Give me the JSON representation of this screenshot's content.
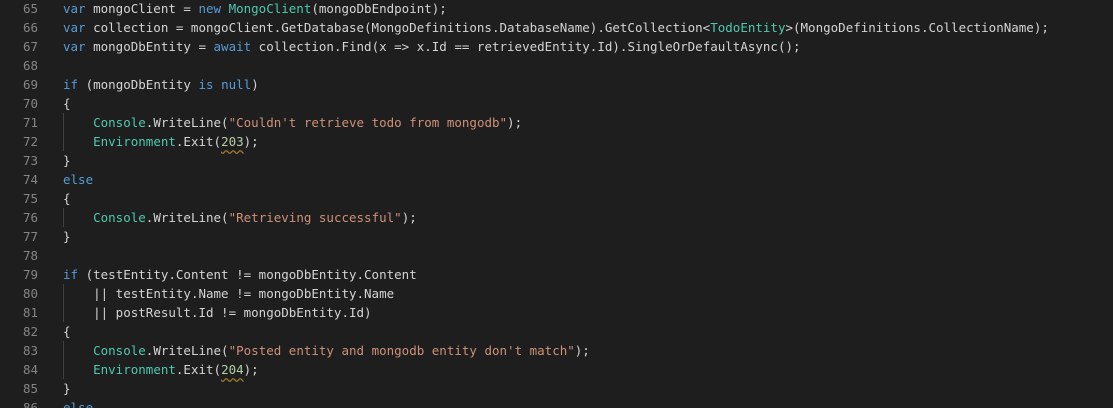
{
  "editor": {
    "colors": {
      "background": "#1e1e1e",
      "keyword": "#569cd6",
      "type": "#4ec9b0",
      "string": "#ce9178",
      "number": "#b5cea8",
      "text": "#d4d4d4",
      "line_number": "#858585"
    },
    "lines": [
      {
        "number": "65",
        "indent": 0,
        "tokens": [
          {
            "t": "var",
            "c": "kw"
          },
          {
            "t": " mongoClient = ",
            "c": "pl"
          },
          {
            "t": "new",
            "c": "kw"
          },
          {
            "t": " ",
            "c": "pl"
          },
          {
            "t": "MongoClient",
            "c": "ty"
          },
          {
            "t": "(mongoDbEndpoint);",
            "c": "pl"
          }
        ]
      },
      {
        "number": "66",
        "indent": 0,
        "tokens": [
          {
            "t": "var",
            "c": "kw"
          },
          {
            "t": " collection = mongoClient.GetDatabase(MongoDefinitions.DatabaseName).GetCollection<",
            "c": "pl"
          },
          {
            "t": "TodoEntity",
            "c": "ty"
          },
          {
            "t": ">(MongoDefinitions.CollectionName);",
            "c": "pl"
          }
        ]
      },
      {
        "number": "67",
        "indent": 0,
        "tokens": [
          {
            "t": "var",
            "c": "kw"
          },
          {
            "t": " mongoDbEntity = ",
            "c": "pl"
          },
          {
            "t": "await",
            "c": "kw"
          },
          {
            "t": " collection.Find(x => x.Id == retrievedEntity.Id).SingleOrDefaultAsync();",
            "c": "pl"
          }
        ]
      },
      {
        "number": "68",
        "indent": 0,
        "tokens": []
      },
      {
        "number": "69",
        "indent": 0,
        "tokens": [
          {
            "t": "if",
            "c": "kw"
          },
          {
            "t": " (mongoDbEntity ",
            "c": "pl"
          },
          {
            "t": "is",
            "c": "kw"
          },
          {
            "t": " ",
            "c": "pl"
          },
          {
            "t": "null",
            "c": "kw"
          },
          {
            "t": ")",
            "c": "pl"
          }
        ]
      },
      {
        "number": "70",
        "indent": 0,
        "tokens": [
          {
            "t": "{",
            "c": "pl"
          }
        ]
      },
      {
        "number": "71",
        "indent": 1,
        "tokens": [
          {
            "t": "Console",
            "c": "ty"
          },
          {
            "t": ".WriteLine(",
            "c": "pl"
          },
          {
            "t": "\"Couldn't retrieve todo from mongodb\"",
            "c": "str"
          },
          {
            "t": ");",
            "c": "pl"
          }
        ]
      },
      {
        "number": "72",
        "indent": 1,
        "tokens": [
          {
            "t": "Environment",
            "c": "ty"
          },
          {
            "t": ".Exit(",
            "c": "pl"
          },
          {
            "t": "203",
            "c": "num sq"
          },
          {
            "t": ");",
            "c": "pl"
          }
        ]
      },
      {
        "number": "73",
        "indent": 0,
        "tokens": [
          {
            "t": "}",
            "c": "pl"
          }
        ]
      },
      {
        "number": "74",
        "indent": 0,
        "tokens": [
          {
            "t": "else",
            "c": "kw"
          }
        ]
      },
      {
        "number": "75",
        "indent": 0,
        "tokens": [
          {
            "t": "{",
            "c": "pl"
          }
        ]
      },
      {
        "number": "76",
        "indent": 1,
        "tokens": [
          {
            "t": "Console",
            "c": "ty"
          },
          {
            "t": ".WriteLine(",
            "c": "pl"
          },
          {
            "t": "\"Retrieving successful\"",
            "c": "str"
          },
          {
            "t": ");",
            "c": "pl"
          }
        ]
      },
      {
        "number": "77",
        "indent": 0,
        "tokens": [
          {
            "t": "}",
            "c": "pl"
          }
        ]
      },
      {
        "number": "78",
        "indent": 0,
        "tokens": []
      },
      {
        "number": "79",
        "indent": 0,
        "tokens": [
          {
            "t": "if",
            "c": "kw"
          },
          {
            "t": " (testEntity.Content != mongoDbEntity.Content",
            "c": "pl"
          }
        ]
      },
      {
        "number": "80",
        "indent": 1,
        "tokens": [
          {
            "t": "|| testEntity.Name != mongoDbEntity.Name",
            "c": "pl"
          }
        ]
      },
      {
        "number": "81",
        "indent": 1,
        "tokens": [
          {
            "t": "|| postResult.Id != mongoDbEntity.Id)",
            "c": "pl"
          }
        ]
      },
      {
        "number": "82",
        "indent": 0,
        "tokens": [
          {
            "t": "{",
            "c": "pl"
          }
        ]
      },
      {
        "number": "83",
        "indent": 1,
        "tokens": [
          {
            "t": "Console",
            "c": "ty"
          },
          {
            "t": ".WriteLine(",
            "c": "pl"
          },
          {
            "t": "\"Posted entity and mongodb entity don't match\"",
            "c": "str"
          },
          {
            "t": ");",
            "c": "pl"
          }
        ]
      },
      {
        "number": "84",
        "indent": 1,
        "tokens": [
          {
            "t": "Environment",
            "c": "ty"
          },
          {
            "t": ".Exit(",
            "c": "pl"
          },
          {
            "t": "204",
            "c": "num sq"
          },
          {
            "t": ");",
            "c": "pl"
          }
        ]
      },
      {
        "number": "85",
        "indent": 0,
        "tokens": [
          {
            "t": "}",
            "c": "pl"
          }
        ]
      },
      {
        "number": "86",
        "indent": 0,
        "tokens": [
          {
            "t": "else",
            "c": "kw"
          }
        ]
      }
    ]
  }
}
